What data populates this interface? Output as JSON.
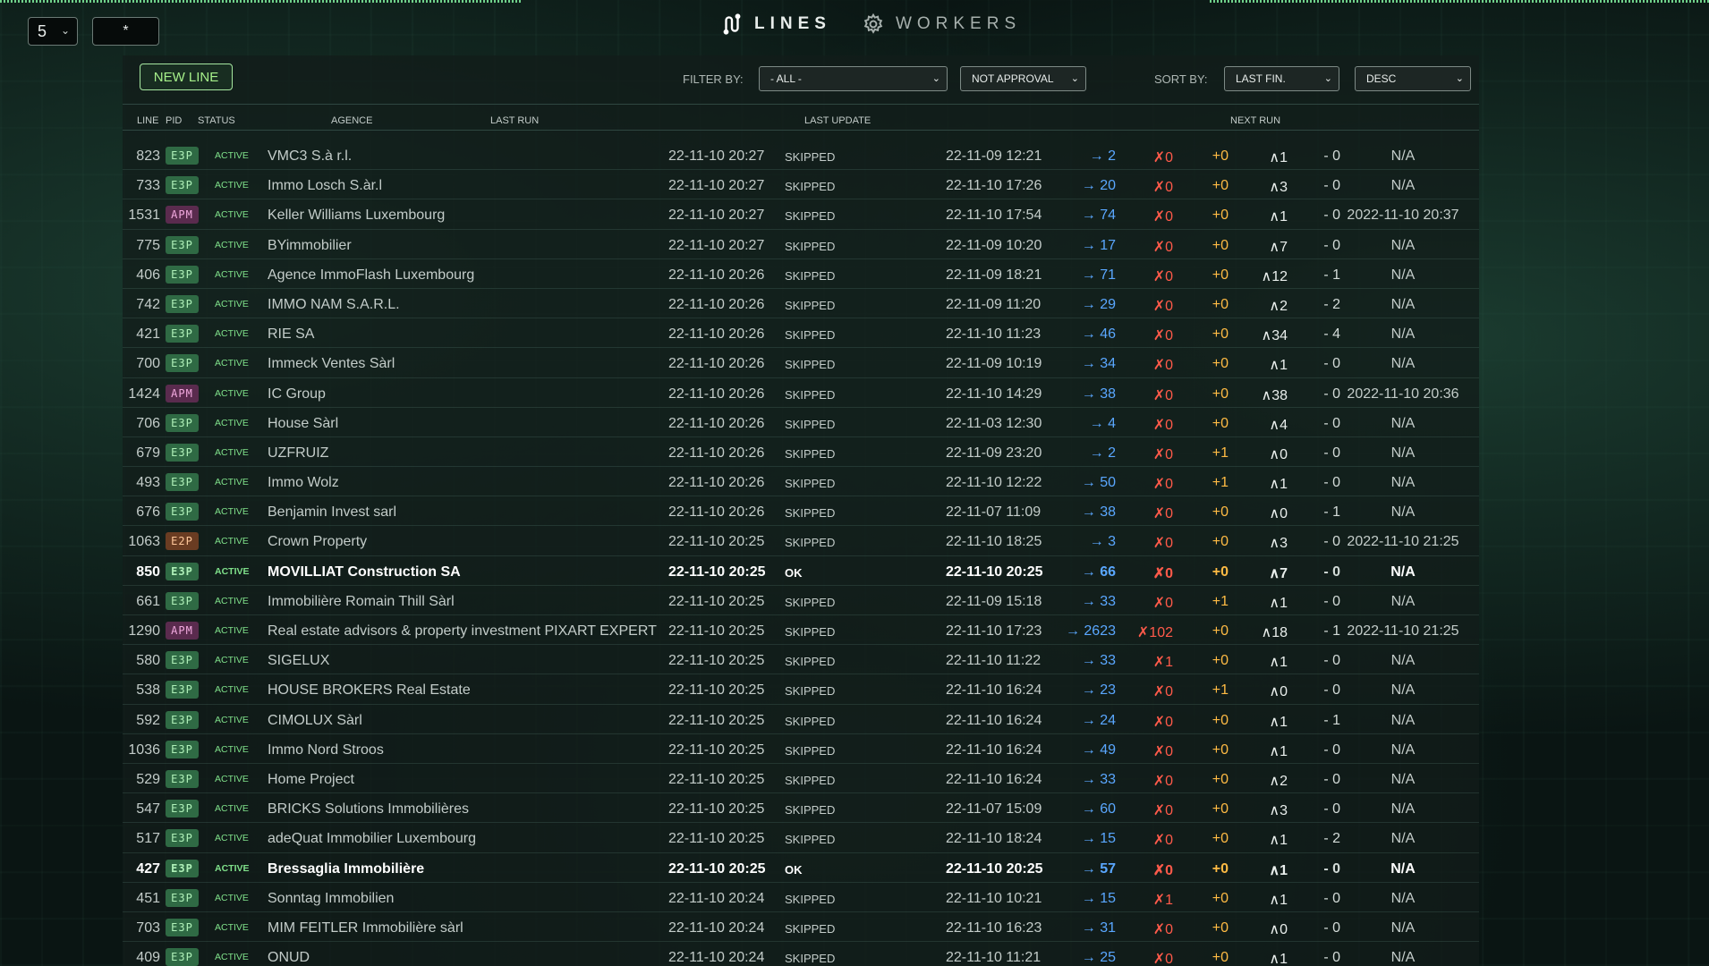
{
  "controls": {
    "page_size": "5",
    "search_value": "*"
  },
  "nav": {
    "lines_label": "LINES",
    "workers_label": "WORKERS"
  },
  "toolbar": {
    "new_line_label": "NEW LINE",
    "filter_label": "FILTER BY:",
    "filter_agence": "- ALL -",
    "filter_status": "NOT APPROVAL",
    "sort_label": "SORT BY:",
    "sort_field": "LAST FIN.",
    "sort_order": "DESC"
  },
  "columns": {
    "line": "LINE",
    "pid": "PID",
    "status": "STATUS",
    "agence": "AGENCE",
    "last_run": "LAST RUN",
    "last_update": "LAST UPDATE",
    "next_run": "NEXT RUN"
  },
  "colors": {
    "accent_green": "#a6f08a",
    "arrow_blue": "#5aa7ff",
    "error_red": "#ff5a4a",
    "plus_orange": "#ffbb44"
  },
  "rows": [
    {
      "line": "823",
      "pid": "E3P",
      "status": "ACTIVE",
      "agence": "VMC3 S.à r.l.",
      "last_run": "22-11-10 20:27",
      "state": "SKIPPED",
      "update": "22-11-09 12:21",
      "arrow": "→ 2",
      "x": "✗0",
      "plus": "+0",
      "caret": "∧1",
      "minus": "- 0",
      "next": "N/A",
      "bright": false
    },
    {
      "line": "733",
      "pid": "E3P",
      "status": "ACTIVE",
      "agence": "Immo Losch S.àr.l",
      "last_run": "22-11-10 20:27",
      "state": "SKIPPED",
      "update": "22-11-10 17:26",
      "arrow": "→ 20",
      "x": "✗0",
      "plus": "+0",
      "caret": "∧3",
      "minus": "- 0",
      "next": "N/A",
      "bright": false
    },
    {
      "line": "1531",
      "pid": "APM",
      "status": "ACTIVE",
      "agence": "Keller Williams Luxembourg",
      "last_run": "22-11-10 20:27",
      "state": "SKIPPED",
      "update": "22-11-10 17:54",
      "arrow": "→ 74",
      "x": "✗0",
      "plus": "+0",
      "caret": "∧1",
      "minus": "- 0",
      "next": "2022-11-10 20:37",
      "bright": false
    },
    {
      "line": "775",
      "pid": "E3P",
      "status": "ACTIVE",
      "agence": "BYimmobilier",
      "last_run": "22-11-10 20:27",
      "state": "SKIPPED",
      "update": "22-11-09 10:20",
      "arrow": "→ 17",
      "x": "✗0",
      "plus": "+0",
      "caret": "∧7",
      "minus": "- 0",
      "next": "N/A",
      "bright": false
    },
    {
      "line": "406",
      "pid": "E3P",
      "status": "ACTIVE",
      "agence": "Agence ImmoFlash Luxembourg",
      "last_run": "22-11-10 20:26",
      "state": "SKIPPED",
      "update": "22-11-09 18:21",
      "arrow": "→ 71",
      "x": "✗0",
      "plus": "+0",
      "caret": "∧12",
      "minus": "- 1",
      "next": "N/A",
      "bright": false
    },
    {
      "line": "742",
      "pid": "E3P",
      "status": "ACTIVE",
      "agence": "IMMO NAM S.A.R.L.",
      "last_run": "22-11-10 20:26",
      "state": "SKIPPED",
      "update": "22-11-09 11:20",
      "arrow": "→ 29",
      "x": "✗0",
      "plus": "+0",
      "caret": "∧2",
      "minus": "- 2",
      "next": "N/A",
      "bright": false
    },
    {
      "line": "421",
      "pid": "E3P",
      "status": "ACTIVE",
      "agence": "RIE SA",
      "last_run": "22-11-10 20:26",
      "state": "SKIPPED",
      "update": "22-11-10 11:23",
      "arrow": "→ 46",
      "x": "✗0",
      "plus": "+0",
      "caret": "∧34",
      "minus": "- 4",
      "next": "N/A",
      "bright": false
    },
    {
      "line": "700",
      "pid": "E3P",
      "status": "ACTIVE",
      "agence": "Immeck Ventes Sàrl",
      "last_run": "22-11-10 20:26",
      "state": "SKIPPED",
      "update": "22-11-09 10:19",
      "arrow": "→ 34",
      "x": "✗0",
      "plus": "+0",
      "caret": "∧1",
      "minus": "- 0",
      "next": "N/A",
      "bright": false
    },
    {
      "line": "1424",
      "pid": "APM",
      "status": "ACTIVE",
      "agence": "IC Group",
      "last_run": "22-11-10 20:26",
      "state": "SKIPPED",
      "update": "22-11-10 14:29",
      "arrow": "→ 38",
      "x": "✗0",
      "plus": "+0",
      "caret": "∧38",
      "minus": "- 0",
      "next": "2022-11-10 20:36",
      "bright": false
    },
    {
      "line": "706",
      "pid": "E3P",
      "status": "ACTIVE",
      "agence": "House Sàrl",
      "last_run": "22-11-10 20:26",
      "state": "SKIPPED",
      "update": "22-11-03 12:30",
      "arrow": "→ 4",
      "x": "✗0",
      "plus": "+0",
      "caret": "∧4",
      "minus": "- 0",
      "next": "N/A",
      "bright": false
    },
    {
      "line": "679",
      "pid": "E3P",
      "status": "ACTIVE",
      "agence": "UZFRUIZ",
      "last_run": "22-11-10 20:26",
      "state": "SKIPPED",
      "update": "22-11-09 23:20",
      "arrow": "→ 2",
      "x": "✗0",
      "plus": "+1",
      "caret": "∧0",
      "minus": "- 0",
      "next": "N/A",
      "bright": false
    },
    {
      "line": "493",
      "pid": "E3P",
      "status": "ACTIVE",
      "agence": "Immo Wolz",
      "last_run": "22-11-10 20:26",
      "state": "SKIPPED",
      "update": "22-11-10 12:22",
      "arrow": "→ 50",
      "x": "✗0",
      "plus": "+1",
      "caret": "∧1",
      "minus": "- 0",
      "next": "N/A",
      "bright": false
    },
    {
      "line": "676",
      "pid": "E3P",
      "status": "ACTIVE",
      "agence": "Benjamin Invest sarl",
      "last_run": "22-11-10 20:26",
      "state": "SKIPPED",
      "update": "22-11-07 11:09",
      "arrow": "→ 38",
      "x": "✗0",
      "plus": "+0",
      "caret": "∧0",
      "minus": "- 1",
      "next": "N/A",
      "bright": false
    },
    {
      "line": "1063",
      "pid": "E2P",
      "status": "ACTIVE",
      "agence": "Crown Property",
      "last_run": "22-11-10 20:25",
      "state": "SKIPPED",
      "update": "22-11-10 18:25",
      "arrow": "→ 3",
      "x": "✗0",
      "plus": "+0",
      "caret": "∧3",
      "minus": "- 0",
      "next": "2022-11-10 21:25",
      "bright": false
    },
    {
      "line": "850",
      "pid": "E3P",
      "status": "ACTIVE",
      "agence": "MOVILLIAT Construction SA",
      "last_run": "22-11-10 20:25",
      "state": "OK",
      "update": "22-11-10 20:25",
      "arrow": "→ 66",
      "x": "✗0",
      "plus": "+0",
      "caret": "∧7",
      "minus": "- 0",
      "next": "N/A",
      "bright": true
    },
    {
      "line": "661",
      "pid": "E3P",
      "status": "ACTIVE",
      "agence": "Immobilière Romain Thill Sàrl",
      "last_run": "22-11-10 20:25",
      "state": "SKIPPED",
      "update": "22-11-09 15:18",
      "arrow": "→ 33",
      "x": "✗0",
      "plus": "+1",
      "caret": "∧1",
      "minus": "- 0",
      "next": "N/A",
      "bright": false
    },
    {
      "line": "1290",
      "pid": "APM",
      "status": "ACTIVE",
      "agence": "Real estate advisors & property investment PIXART EXPERT",
      "last_run": "22-11-10 20:25",
      "state": "SKIPPED",
      "update": "22-11-10 17:23",
      "arrow": "→ 2623",
      "x": "✗102",
      "plus": "+0",
      "caret": "∧18",
      "minus": "- 1",
      "next": "2022-11-10 21:25",
      "bright": false
    },
    {
      "line": "580",
      "pid": "E3P",
      "status": "ACTIVE",
      "agence": "SIGELUX",
      "last_run": "22-11-10 20:25",
      "state": "SKIPPED",
      "update": "22-11-10 11:22",
      "arrow": "→ 33",
      "x": "✗1",
      "plus": "+0",
      "caret": "∧1",
      "minus": "- 0",
      "next": "N/A",
      "bright": false
    },
    {
      "line": "538",
      "pid": "E3P",
      "status": "ACTIVE",
      "agence": "HOUSE BROKERS Real Estate",
      "last_run": "22-11-10 20:25",
      "state": "SKIPPED",
      "update": "22-11-10 16:24",
      "arrow": "→ 23",
      "x": "✗0",
      "plus": "+1",
      "caret": "∧0",
      "minus": "- 0",
      "next": "N/A",
      "bright": false
    },
    {
      "line": "592",
      "pid": "E3P",
      "status": "ACTIVE",
      "agence": "CIMOLUX Sàrl",
      "last_run": "22-11-10 20:25",
      "state": "SKIPPED",
      "update": "22-11-10 16:24",
      "arrow": "→ 24",
      "x": "✗0",
      "plus": "+0",
      "caret": "∧1",
      "minus": "- 1",
      "next": "N/A",
      "bright": false
    },
    {
      "line": "1036",
      "pid": "E3P",
      "status": "ACTIVE",
      "agence": "Immo Nord Stroos",
      "last_run": "22-11-10 20:25",
      "state": "SKIPPED",
      "update": "22-11-10 16:24",
      "arrow": "→ 49",
      "x": "✗0",
      "plus": "+0",
      "caret": "∧1",
      "minus": "- 0",
      "next": "N/A",
      "bright": false
    },
    {
      "line": "529",
      "pid": "E3P",
      "status": "ACTIVE",
      "agence": "Home Project",
      "last_run": "22-11-10 20:25",
      "state": "SKIPPED",
      "update": "22-11-10 16:24",
      "arrow": "→ 33",
      "x": "✗0",
      "plus": "+0",
      "caret": "∧2",
      "minus": "- 0",
      "next": "N/A",
      "bright": false
    },
    {
      "line": "547",
      "pid": "E3P",
      "status": "ACTIVE",
      "agence": "BRICKS Solutions Immobilières",
      "last_run": "22-11-10 20:25",
      "state": "SKIPPED",
      "update": "22-11-07 15:09",
      "arrow": "→ 60",
      "x": "✗0",
      "plus": "+0",
      "caret": "∧3",
      "minus": "- 0",
      "next": "N/A",
      "bright": false
    },
    {
      "line": "517",
      "pid": "E3P",
      "status": "ACTIVE",
      "agence": "adeQuat Immobilier Luxembourg",
      "last_run": "22-11-10 20:25",
      "state": "SKIPPED",
      "update": "22-11-10 18:24",
      "arrow": "→ 15",
      "x": "✗0",
      "plus": "+0",
      "caret": "∧1",
      "minus": "- 2",
      "next": "N/A",
      "bright": false
    },
    {
      "line": "427",
      "pid": "E3P",
      "status": "ACTIVE",
      "agence": "Bressaglia Immobilière",
      "last_run": "22-11-10 20:25",
      "state": "OK",
      "update": "22-11-10 20:25",
      "arrow": "→ 57",
      "x": "✗0",
      "plus": "+0",
      "caret": "∧1",
      "minus": "- 0",
      "next": "N/A",
      "bright": true
    },
    {
      "line": "451",
      "pid": "E3P",
      "status": "ACTIVE",
      "agence": "Sonntag Immobilien",
      "last_run": "22-11-10 20:24",
      "state": "SKIPPED",
      "update": "22-11-10 10:21",
      "arrow": "→ 15",
      "x": "✗1",
      "plus": "+0",
      "caret": "∧1",
      "minus": "- 0",
      "next": "N/A",
      "bright": false
    },
    {
      "line": "703",
      "pid": "E3P",
      "status": "ACTIVE",
      "agence": "MIM FEITLER Immobilière sàrl",
      "last_run": "22-11-10 20:24",
      "state": "SKIPPED",
      "update": "22-11-10 16:23",
      "arrow": "→ 31",
      "x": "✗0",
      "plus": "+0",
      "caret": "∧0",
      "minus": "- 0",
      "next": "N/A",
      "bright": false
    },
    {
      "line": "409",
      "pid": "E3P",
      "status": "ACTIVE",
      "agence": "ONUD",
      "last_run": "22-11-10 20:24",
      "state": "SKIPPED",
      "update": "22-11-10 11:21",
      "arrow": "→ 25",
      "x": "✗0",
      "plus": "+0",
      "caret": "∧1",
      "minus": "- 0",
      "next": "N/A",
      "bright": false
    }
  ]
}
